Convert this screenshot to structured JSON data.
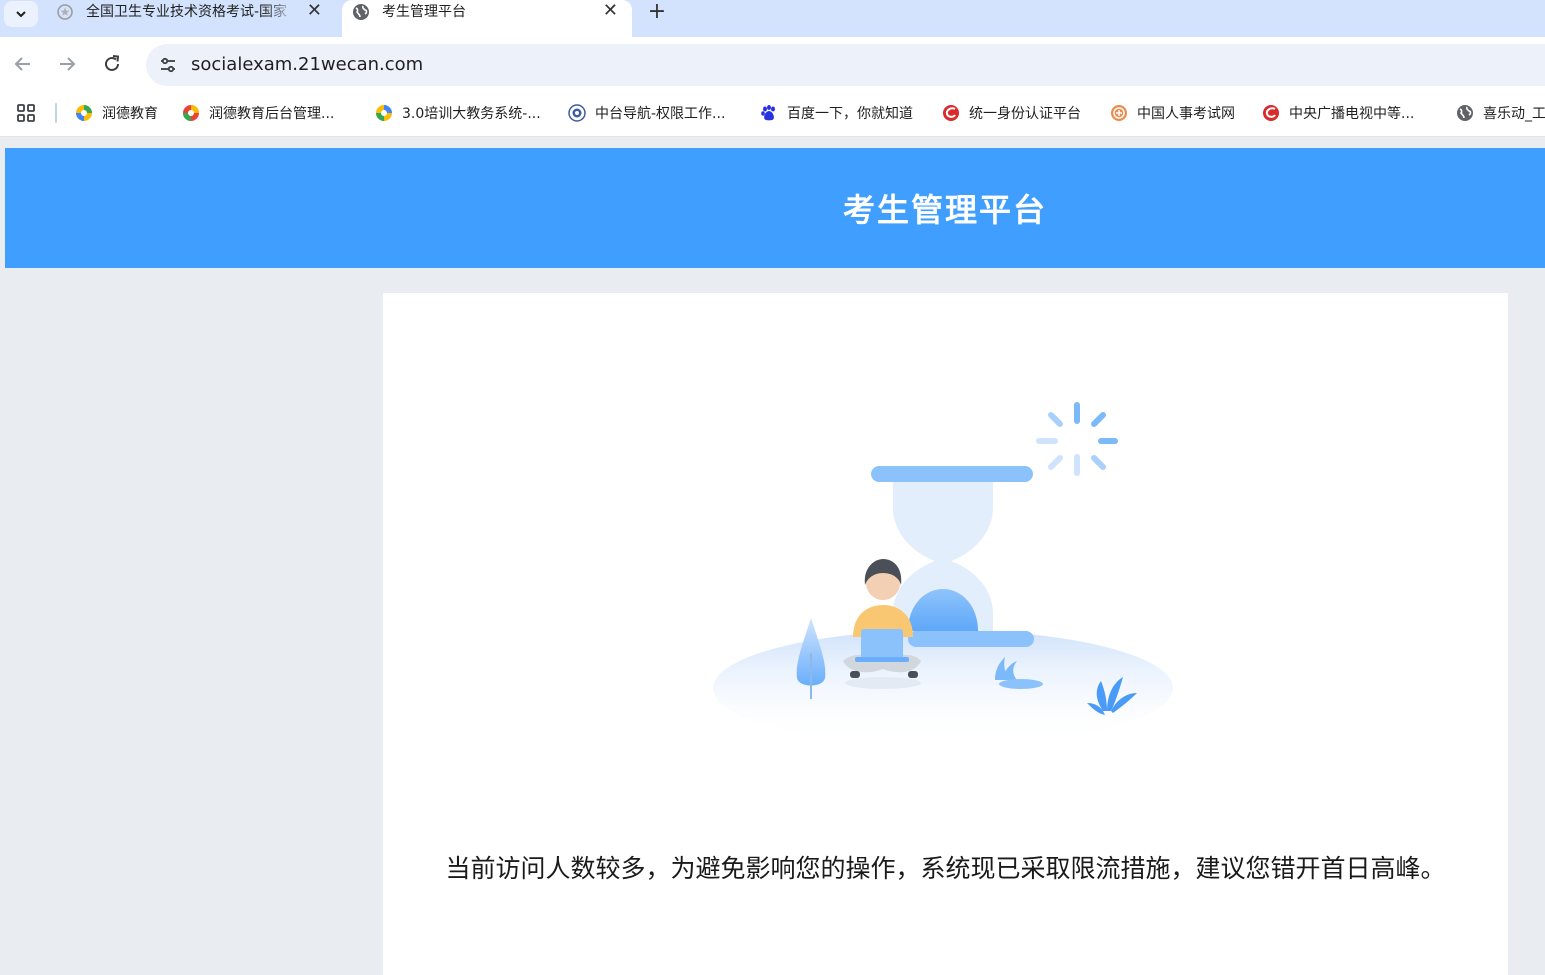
{
  "browser": {
    "tabs": [
      {
        "title": "全国卫生专业技术资格考试-国家",
        "close": "✕",
        "favicon": "award-icon",
        "active": false
      },
      {
        "title": "考生管理平台",
        "close": "✕",
        "favicon": "globe-icon",
        "active": true
      }
    ],
    "new_tab": "+",
    "url": "socialexam.21wecan.com"
  },
  "bookmarks": [
    {
      "label": "润德教育",
      "icon": "runde-logo-icon",
      "color": "#f5a623"
    },
    {
      "label": "润德教育后台管理...",
      "icon": "runde-logo-icon",
      "color": "#f5a623"
    },
    {
      "label": "3.0培训大教务系统-...",
      "icon": "runde-logo-icon",
      "color": "#f5a623"
    },
    {
      "label": "中台导航-权限工作...",
      "icon": "emblem-icon",
      "color": "#3b5ba5"
    },
    {
      "label": "百度一下，你就知道",
      "icon": "baidu-paw-icon",
      "color": "#2932e1"
    },
    {
      "label": "统一身份认证平台",
      "icon": "red-swirl-icon",
      "color": "#d92b2b"
    },
    {
      "label": "中国人事考试网",
      "icon": "seal-icon",
      "color": "#f08a4b"
    },
    {
      "label": "中央广播电视中等...",
      "icon": "red-swirl-icon",
      "color": "#d92b2b"
    },
    {
      "label": "喜乐动_工",
      "icon": "globe-icon",
      "color": "#555555"
    }
  ],
  "page": {
    "header_title": "考生管理平台",
    "notice": "当前访问人数较多，为避免影响您的操作，系统现已采取限流措施，建议您错开首日高峰。",
    "accent_color": "#409eff"
  }
}
